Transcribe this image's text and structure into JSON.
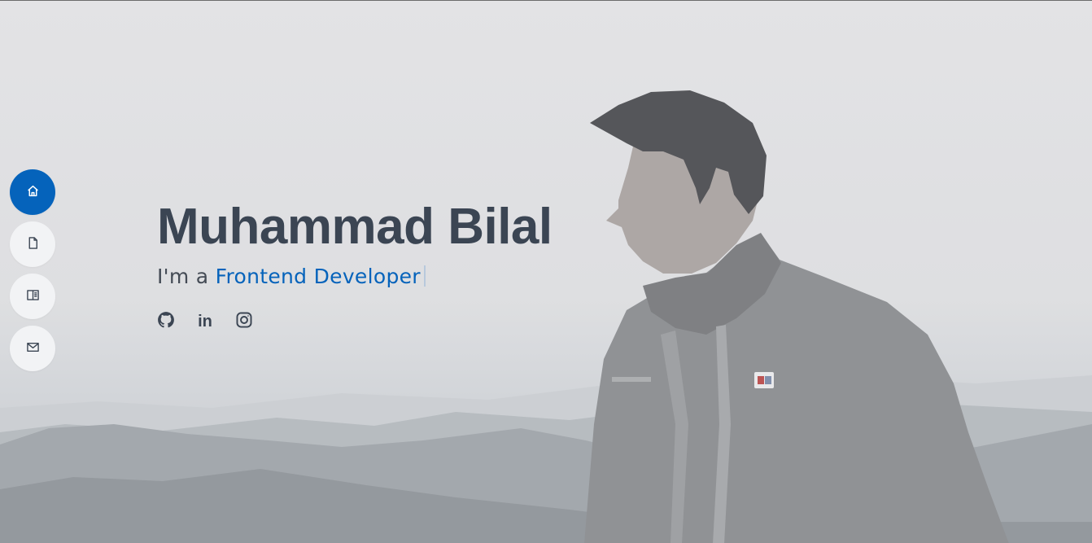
{
  "hero": {
    "name": "Muhammad Bilal",
    "intro_prefix": "I'm a ",
    "role": "Frontend Developer"
  },
  "nav": {
    "items": [
      {
        "name": "home",
        "icon": "home-icon",
        "active": true
      },
      {
        "name": "resume",
        "icon": "file-icon",
        "active": false
      },
      {
        "name": "portfolio",
        "icon": "book-icon",
        "active": false
      },
      {
        "name": "contact",
        "icon": "envelope-icon",
        "active": false
      }
    ]
  },
  "social": {
    "items": [
      {
        "name": "github",
        "icon": "github-icon"
      },
      {
        "name": "linkedin",
        "icon": "linkedin-icon",
        "glyph": "in"
      },
      {
        "name": "instagram",
        "icon": "instagram-icon"
      }
    ]
  },
  "colors": {
    "accent": "#0563bb",
    "heading": "#3b4553",
    "nav_bg": "#f2f3f5"
  }
}
